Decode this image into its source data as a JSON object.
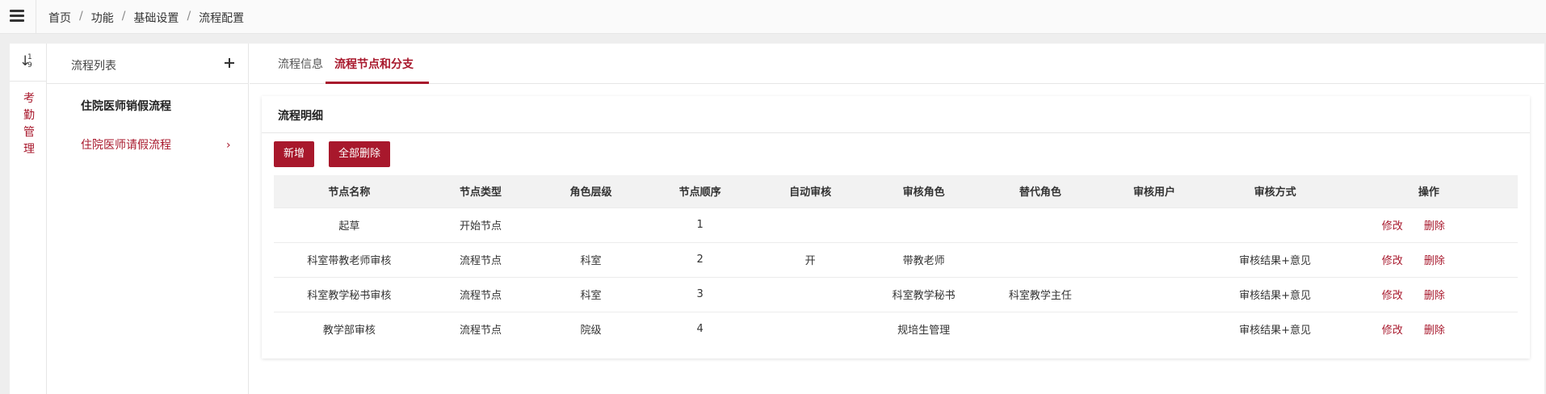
{
  "breadcrumb": [
    "首页",
    "功能",
    "基础设置",
    "流程配置"
  ],
  "rail": {
    "label_chars": [
      "考",
      "勤",
      "管",
      "理"
    ]
  },
  "process_list": {
    "title": "流程列表",
    "items": [
      {
        "label": "住院医师销假流程"
      },
      {
        "label": "住院医师请假流程"
      }
    ]
  },
  "tabs": [
    {
      "label": "流程信息"
    },
    {
      "label": "流程节点和分支"
    }
  ],
  "detail": {
    "title": "流程明细",
    "add_label": "新增",
    "delete_all_label": "全部删除",
    "columns": [
      "节点名称",
      "节点类型",
      "角色层级",
      "节点顺序",
      "自动审核",
      "审核角色",
      "替代角色",
      "审核用户",
      "审核方式",
      "操作"
    ],
    "rows": [
      [
        "起草",
        "开始节点",
        "",
        "1",
        "",
        "",
        "",
        "",
        ""
      ],
      [
        "科室带教老师审核",
        "流程节点",
        "科室",
        "2",
        "开",
        "带教老师",
        "",
        "",
        "审核结果+意见"
      ],
      [
        "科室教学秘书审核",
        "流程节点",
        "科室",
        "3",
        "",
        "科室教学秘书",
        "科室教学主任",
        "",
        "审核结果+意见"
      ],
      [
        "教学部审核",
        "流程节点",
        "院级",
        "4",
        "",
        "规培生管理",
        "",
        "",
        "审核结果+意见"
      ]
    ],
    "edit_label": "修改",
    "delete_label": "删除"
  },
  "colors": {
    "accent": "#a8182c"
  }
}
